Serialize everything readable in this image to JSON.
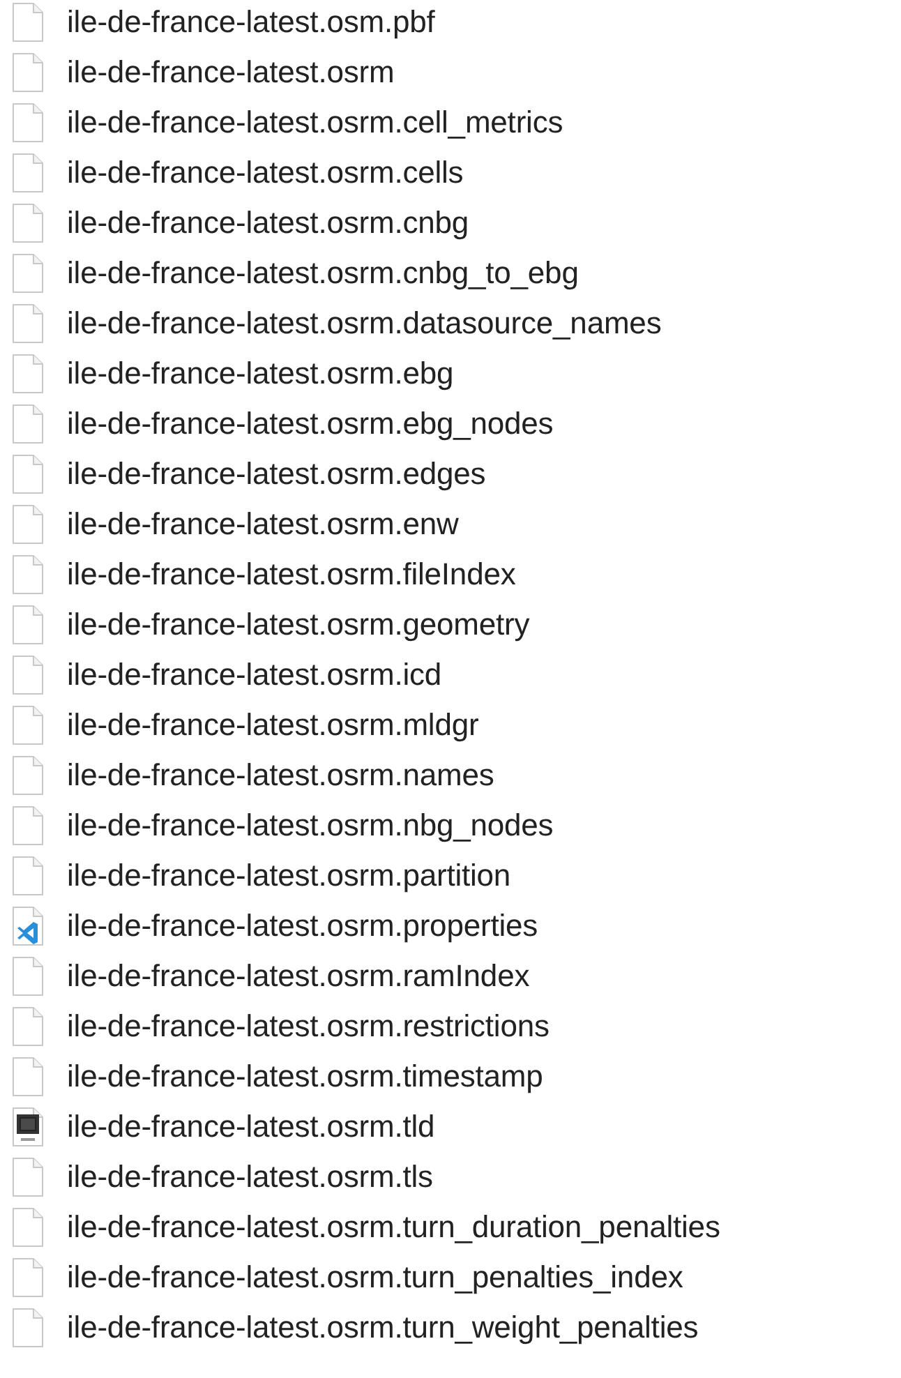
{
  "files": [
    {
      "name": "ile-de-france-latest.osm.pbf",
      "kind": "document"
    },
    {
      "name": "ile-de-france-latest.osrm",
      "kind": "document"
    },
    {
      "name": "ile-de-france-latest.osrm.cell_metrics",
      "kind": "document"
    },
    {
      "name": "ile-de-france-latest.osrm.cells",
      "kind": "document"
    },
    {
      "name": "ile-de-france-latest.osrm.cnbg",
      "kind": "document"
    },
    {
      "name": "ile-de-france-latest.osrm.cnbg_to_ebg",
      "kind": "document"
    },
    {
      "name": "ile-de-france-latest.osrm.datasource_names",
      "kind": "document"
    },
    {
      "name": "ile-de-france-latest.osrm.ebg",
      "kind": "document"
    },
    {
      "name": "ile-de-france-latest.osrm.ebg_nodes",
      "kind": "document"
    },
    {
      "name": "ile-de-france-latest.osrm.edges",
      "kind": "document"
    },
    {
      "name": "ile-de-france-latest.osrm.enw",
      "kind": "document"
    },
    {
      "name": "ile-de-france-latest.osrm.fileIndex",
      "kind": "document"
    },
    {
      "name": "ile-de-france-latest.osrm.geometry",
      "kind": "document"
    },
    {
      "name": "ile-de-france-latest.osrm.icd",
      "kind": "document"
    },
    {
      "name": "ile-de-france-latest.osrm.mldgr",
      "kind": "document"
    },
    {
      "name": "ile-de-france-latest.osrm.names",
      "kind": "document"
    },
    {
      "name": "ile-de-france-latest.osrm.nbg_nodes",
      "kind": "document"
    },
    {
      "name": "ile-de-france-latest.osrm.partition",
      "kind": "document"
    },
    {
      "name": "ile-de-france-latest.osrm.properties",
      "kind": "editor"
    },
    {
      "name": "ile-de-france-latest.osrm.ramIndex",
      "kind": "document"
    },
    {
      "name": "ile-de-france-latest.osrm.restrictions",
      "kind": "document"
    },
    {
      "name": "ile-de-france-latest.osrm.timestamp",
      "kind": "document"
    },
    {
      "name": "ile-de-france-latest.osrm.tld",
      "kind": "xml"
    },
    {
      "name": "ile-de-france-latest.osrm.tls",
      "kind": "document"
    },
    {
      "name": "ile-de-france-latest.osrm.turn_duration_penalties",
      "kind": "document"
    },
    {
      "name": "ile-de-france-latest.osrm.turn_penalties_index",
      "kind": "document"
    },
    {
      "name": "ile-de-france-latest.osrm.turn_weight_penalties",
      "kind": "document"
    }
  ]
}
